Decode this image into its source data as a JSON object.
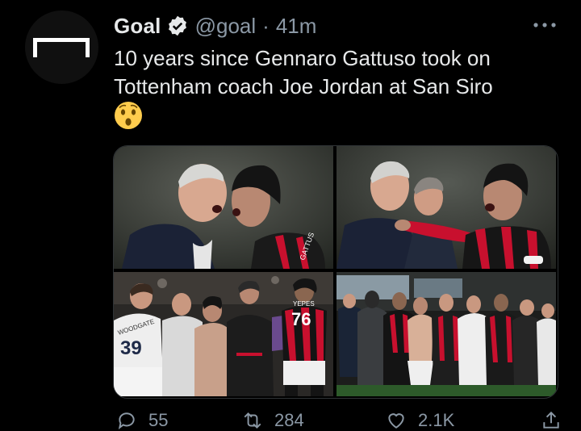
{
  "tweet": {
    "author_name": "Goal",
    "handle": "@goal",
    "separator": "·",
    "time": "41m",
    "text": "10 years since Gennaro Gattuso took on Tottenham coach Joe Jordan at San Siro",
    "emoji": "😯",
    "icons": {
      "avatar": "goal-logo",
      "verified": "verified-badge-icon",
      "more": "more-options-icon"
    }
  },
  "media": {
    "photos": [
      {
        "caption_text": "",
        "jersey_text": "GATTUS"
      },
      {
        "caption_text": "",
        "jersey_text": ""
      },
      {
        "caption_text": "",
        "jersey_text_1": "WOODGATE",
        "jersey_number_1": "39",
        "jersey_text_2": "YEPES",
        "jersey_number_2": "76"
      },
      {
        "caption_text": "",
        "jersey_text": ""
      }
    ]
  },
  "actions": {
    "reply_count": "55",
    "retweet_count": "284",
    "like_count": "2.1K"
  },
  "colors": {
    "background": "#000000",
    "text": "#e7e9ea",
    "muted": "#8b98a5",
    "milan_red": "#c8102e"
  }
}
